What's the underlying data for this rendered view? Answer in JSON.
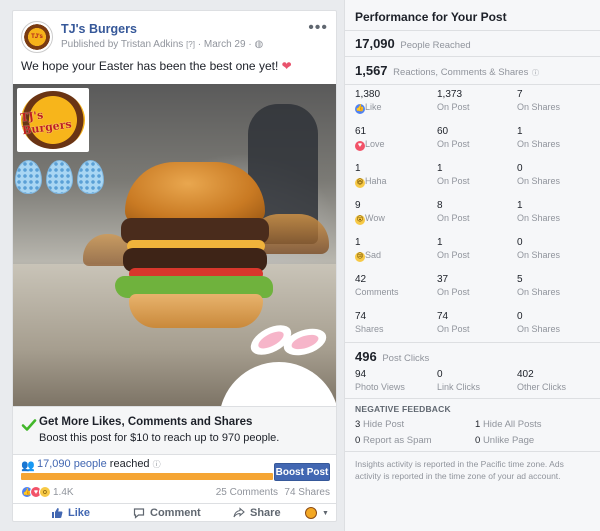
{
  "post": {
    "page_name": "TJ's Burgers",
    "meta": "Published by Tristan Adkins",
    "meta_q": "[?]",
    "date": "March 29",
    "text": "We hope your Easter has been the best one yet!",
    "emoji": "❤",
    "logo_text": "TJ's Burgers",
    "boost_title": "Get More Likes, Comments and Shares",
    "boost_sub": "Boost this post for $10 to reach up to 970 people.",
    "reach_number": "17,090 people",
    "reach_suffix": "reached",
    "boost_button": "Boost Post",
    "reaction_total": "1.4K",
    "comments": "25 Comments",
    "shares": "74 Shares",
    "actions": {
      "like": "Like",
      "comment": "Comment",
      "share": "Share"
    }
  },
  "panel": {
    "title": "Performance for Your Post",
    "people_reached": {
      "value": "17,090",
      "label": "People Reached"
    },
    "engagement": {
      "value": "1,567",
      "label": "Reactions, Comments & Shares"
    },
    "rows": [
      {
        "icon": "like-icon",
        "c0": {
          "v": "1,380",
          "l": "Like"
        },
        "c1": {
          "v": "1,373",
          "l": "On Post"
        },
        "c2": {
          "v": "7",
          "l": "On Shares"
        }
      },
      {
        "icon": "love-icon",
        "c0": {
          "v": "61",
          "l": "Love"
        },
        "c1": {
          "v": "60",
          "l": "On Post"
        },
        "c2": {
          "v": "1",
          "l": "On Shares"
        }
      },
      {
        "icon": "haha-icon",
        "c0": {
          "v": "1",
          "l": "Haha"
        },
        "c1": {
          "v": "1",
          "l": "On Post"
        },
        "c2": {
          "v": "0",
          "l": "On Shares"
        }
      },
      {
        "icon": "wow-icon",
        "c0": {
          "v": "9",
          "l": "Wow"
        },
        "c1": {
          "v": "8",
          "l": "On Post"
        },
        "c2": {
          "v": "1",
          "l": "On Shares"
        }
      },
      {
        "icon": "sad-icon",
        "c0": {
          "v": "1",
          "l": "Sad"
        },
        "c1": {
          "v": "1",
          "l": "On Post"
        },
        "c2": {
          "v": "0",
          "l": "On Shares"
        }
      },
      {
        "icon": "",
        "c0": {
          "v": "42",
          "l": "Comments"
        },
        "c1": {
          "v": "37",
          "l": "On Post"
        },
        "c2": {
          "v": "5",
          "l": "On Shares"
        }
      },
      {
        "icon": "",
        "c0": {
          "v": "74",
          "l": "Shares"
        },
        "c1": {
          "v": "74",
          "l": "On Post"
        },
        "c2": {
          "v": "0",
          "l": "On Shares"
        }
      }
    ],
    "post_clicks": {
      "value": "496",
      "label": "Post Clicks"
    },
    "clicks": [
      {
        "v": "94",
        "l": "Photo Views"
      },
      {
        "v": "0",
        "l": "Link Clicks"
      },
      {
        "v": "402",
        "l": "Other Clicks"
      }
    ],
    "negative_title": "NEGATIVE FEEDBACK",
    "negative": [
      {
        "v": "3",
        "l": "Hide Post"
      },
      {
        "v": "1",
        "l": "Hide All Posts"
      },
      {
        "v": "0",
        "l": "Report as Spam"
      },
      {
        "v": "0",
        "l": "Unlike Page"
      }
    ],
    "footnote": "Insights activity is reported in the Pacific time zone. Ads activity is reported in the time zone of your ad account."
  },
  "colors": {
    "link_blue": "#4267b2",
    "reach_bar": "#f5a533",
    "love": "#f25268"
  }
}
